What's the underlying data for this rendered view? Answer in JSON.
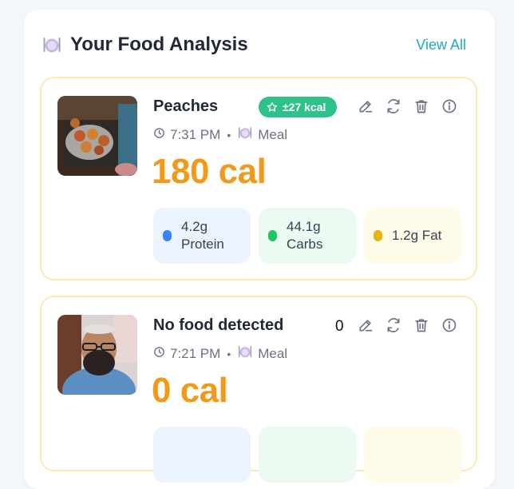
{
  "header": {
    "title": "Your Food Analysis",
    "view_all": "View All"
  },
  "entries": [
    {
      "name": "Peaches",
      "kcal_badge": "±27 kcal",
      "time": "7:31 PM",
      "type": "Meal",
      "calories": "180 cal",
      "protein": "4.2g\nProtein",
      "carbs": "44.1g\nCarbs",
      "fat": "1.2g Fat"
    },
    {
      "name": "No food detected",
      "count": "0",
      "time": "7:21 PM",
      "type": "Meal",
      "calories": "0 cal"
    }
  ],
  "colors": {
    "accent": "#22a7c7",
    "calorie": "#f29a18",
    "badge": "#2ec28a",
    "card_border": "#fbe8b4",
    "protein_dot": "#3b82f6",
    "carbs_dot": "#22c55e",
    "fat_dot": "#eab308"
  }
}
